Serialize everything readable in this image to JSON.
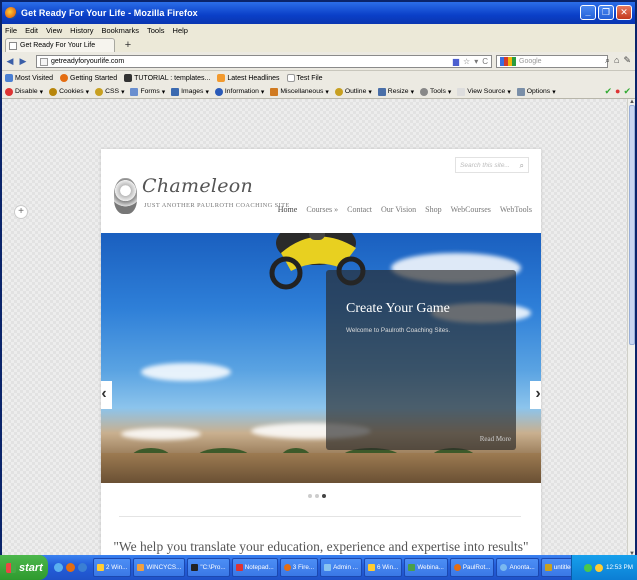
{
  "window": {
    "title": "Get Ready For Your Life - Mozilla Firefox"
  },
  "menubar": [
    "File",
    "Edit",
    "View",
    "History",
    "Bookmarks",
    "Tools",
    "Help"
  ],
  "tab": {
    "label": "Get Ready For Your Life",
    "new_tab": "+"
  },
  "navbar": {
    "url": "getreadyforyourlife.com",
    "search_placeholder": "Google"
  },
  "bookmarks": [
    "Most Visited",
    "Getting Started",
    "TUTORIAL : templates...",
    "Latest Headlines",
    "Test File"
  ],
  "devbar": [
    "Disable",
    "Cookies",
    "CSS",
    "Forms",
    "Images",
    "Information",
    "Miscellaneous",
    "Outline",
    "Resize",
    "Tools",
    "View Source",
    "Options"
  ],
  "site": {
    "search_placeholder": "Search this site...",
    "logo_name": "Chameleon",
    "logo_tagline": "JUST ANOTHER PAULROTH COACHING SITE",
    "nav": [
      "Home",
      "Courses »",
      "Contact",
      "Our Vision",
      "Shop",
      "WebCourses",
      "WebTools"
    ],
    "slide": {
      "title": "Create Your Game",
      "text": "Welcome to Paulroth Coaching Sites.",
      "more": "Read More",
      "prev": "‹",
      "next": "›"
    },
    "tagline": "\"We help you translate your education, experience and expertise into results\""
  },
  "taskbar": {
    "start": "start",
    "tasks": [
      "2 Win...",
      "WINCYCS...",
      "\"C:\\Pro...",
      "Notepad...",
      "3 Fire...",
      "Admin ...",
      "6 Win...",
      "Webina...",
      "PaulRot...",
      "Anonta...",
      "untitled..."
    ],
    "clock": "12:53 PM"
  },
  "colors": {
    "title_bar": "#0a3fc8",
    "taskbar": "#245edb",
    "start": "#2e9a2e",
    "tray": "#0c7ed4"
  }
}
